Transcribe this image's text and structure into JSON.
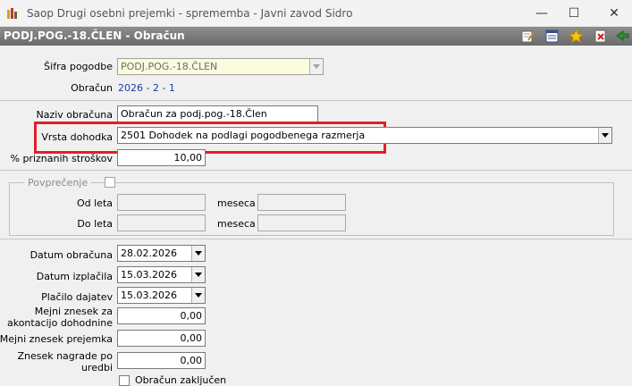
{
  "window": {
    "app_title": "Saop   Drugi osebni prejemki - sprememba - Javni zavod Sidro",
    "minimize": "—",
    "maximize": "☐",
    "close": "✕"
  },
  "form": {
    "title": "PODJ.POG.-18.ČLEN - Obračun"
  },
  "fields": {
    "sifra_pogodbe": {
      "label": "Šifra pogodbe",
      "value": "PODJ.POG.-18.ČLEN"
    },
    "obracun": {
      "label": "Obračun",
      "value": "2026 - 2 - 1"
    },
    "naziv_obracuna": {
      "label": "Naziv obračuna",
      "value": "Obračun za podj.pog.-18.Člen"
    },
    "vrsta_dohodka": {
      "label": "Vrsta dohodka",
      "value": "2501  Dohodek na podlagi pogodbenega razmerja"
    },
    "priznani_stroski": {
      "label": "% priznanih stroškov",
      "value": "10,00"
    }
  },
  "povprecenje": {
    "label": "Povprečenje",
    "od_leta": "Od leta",
    "do_leta": "Do leta",
    "meseca1": "meseca",
    "meseca2": "meseca"
  },
  "dates": {
    "datum_obracuna": {
      "label": "Datum obračuna",
      "value": "28.02.2026"
    },
    "datum_izplacila": {
      "label": "Datum izplačila",
      "value": "15.03.2026"
    },
    "placilo_dajatev": {
      "label": "Plačilo dajatev",
      "value": "15.03.2026"
    }
  },
  "amounts": {
    "mejni_akontacija": {
      "label_line1": "Mejni znesek za",
      "label_line2": "akontacijo dohodnine",
      "value": "0,00"
    },
    "mejni_prejemka": {
      "label": "Mejni znesek prejemka",
      "value": "0,00"
    },
    "znesek_nagrade": {
      "label_line1": "Znesek nagrade po",
      "label_line2": "uredbi",
      "value": "0,00"
    }
  },
  "obracun_zakljucen": {
    "label": "Obračun zaključen"
  },
  "colors": {
    "highlight": "#e0202a",
    "link": "#1a3ea5"
  }
}
